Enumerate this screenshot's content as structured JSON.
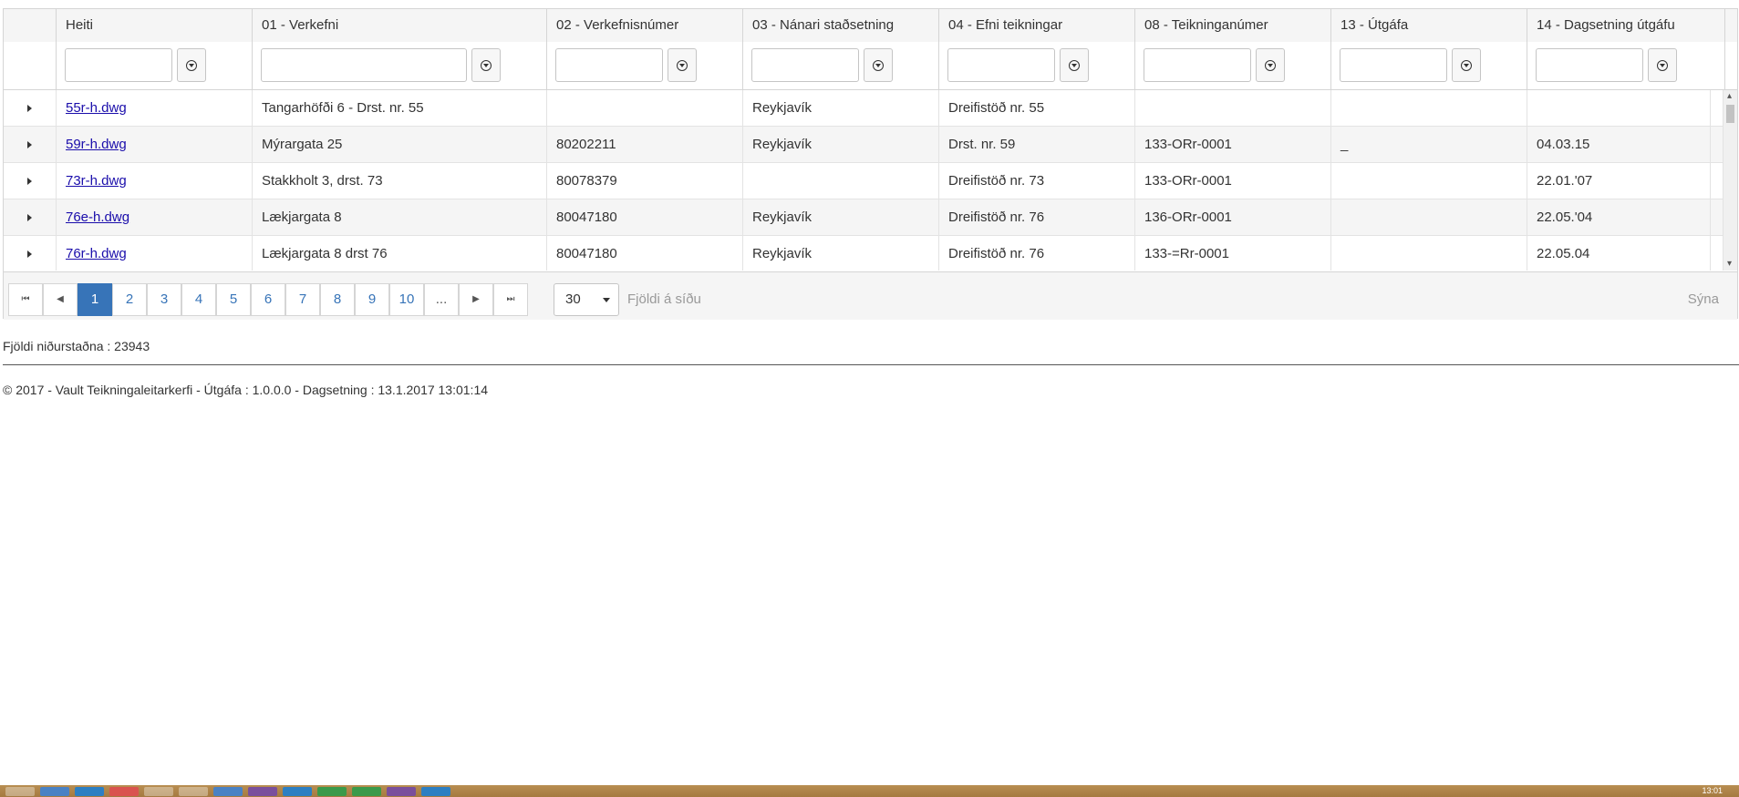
{
  "grid": {
    "columns": [
      "Heiti",
      "01 - Verkefni",
      "02 - Verkefnisnúmer",
      "03 - Nánari staðsetning",
      "04 - Efni teikningar",
      "08 - Teikninganúmer",
      "13 - Útgáfa",
      "14 - Dagsetning útgáfu"
    ],
    "rows": [
      {
        "heiti": "55r-h.dwg",
        "verkefni": "Tangarhöfði 6 - Drst. nr. 55",
        "verkefnisnumer": "",
        "stadsetning": "Reykjavík",
        "efni": "Dreifistöð nr. 55",
        "teikninganumer": "",
        "utgafa": "",
        "dagsetning": ""
      },
      {
        "heiti": "59r-h.dwg",
        "verkefni": "Mýrargata 25",
        "verkefnisnumer": "80202211",
        "stadsetning": "Reykjavík",
        "efni": "Drst. nr. 59",
        "teikninganumer": "133-ORr-0001",
        "utgafa": "_",
        "dagsetning": "04.03.15"
      },
      {
        "heiti": "73r-h.dwg",
        "verkefni": "Stakkholt 3, drst. 73",
        "verkefnisnumer": "80078379",
        "stadsetning": "",
        "efni": "Dreifistöð nr. 73",
        "teikninganumer": "133-ORr-0001",
        "utgafa": "",
        "dagsetning": "22.01.'07"
      },
      {
        "heiti": "76e-h.dwg",
        "verkefni": "Lækjargata 8",
        "verkefnisnumer": "80047180",
        "stadsetning": "Reykjavík",
        "efni": "Dreifistöð nr. 76",
        "teikninganumer": "136-ORr-0001",
        "utgafa": "",
        "dagsetning": "22.05.'04"
      },
      {
        "heiti": "76r-h.dwg",
        "verkefni": "Lækjargata 8 drst 76",
        "verkefnisnumer": "80047180",
        "stadsetning": "Reykjavík",
        "efni": "Dreifistöð nr. 76",
        "teikninganumer": "133-=Rr-0001",
        "utgafa": "",
        "dagsetning": "22.05.04"
      }
    ]
  },
  "pager": {
    "pages": [
      "1",
      "2",
      "3",
      "4",
      "5",
      "6",
      "7",
      "8",
      "9",
      "10",
      "..."
    ],
    "active_page": "1",
    "page_size": "30",
    "page_size_label": "Fjöldi á síðu",
    "info": "Sýna"
  },
  "results_count": "Fjöldi niðurstaðna : 23943",
  "footer": "© 2017 - Vault Teikningaleitarkerfi - Útgáfa : 1.0.0.0 - Dagsetning : 13.1.2017 13:01:14",
  "taskbar": {
    "clock": "13:01"
  }
}
